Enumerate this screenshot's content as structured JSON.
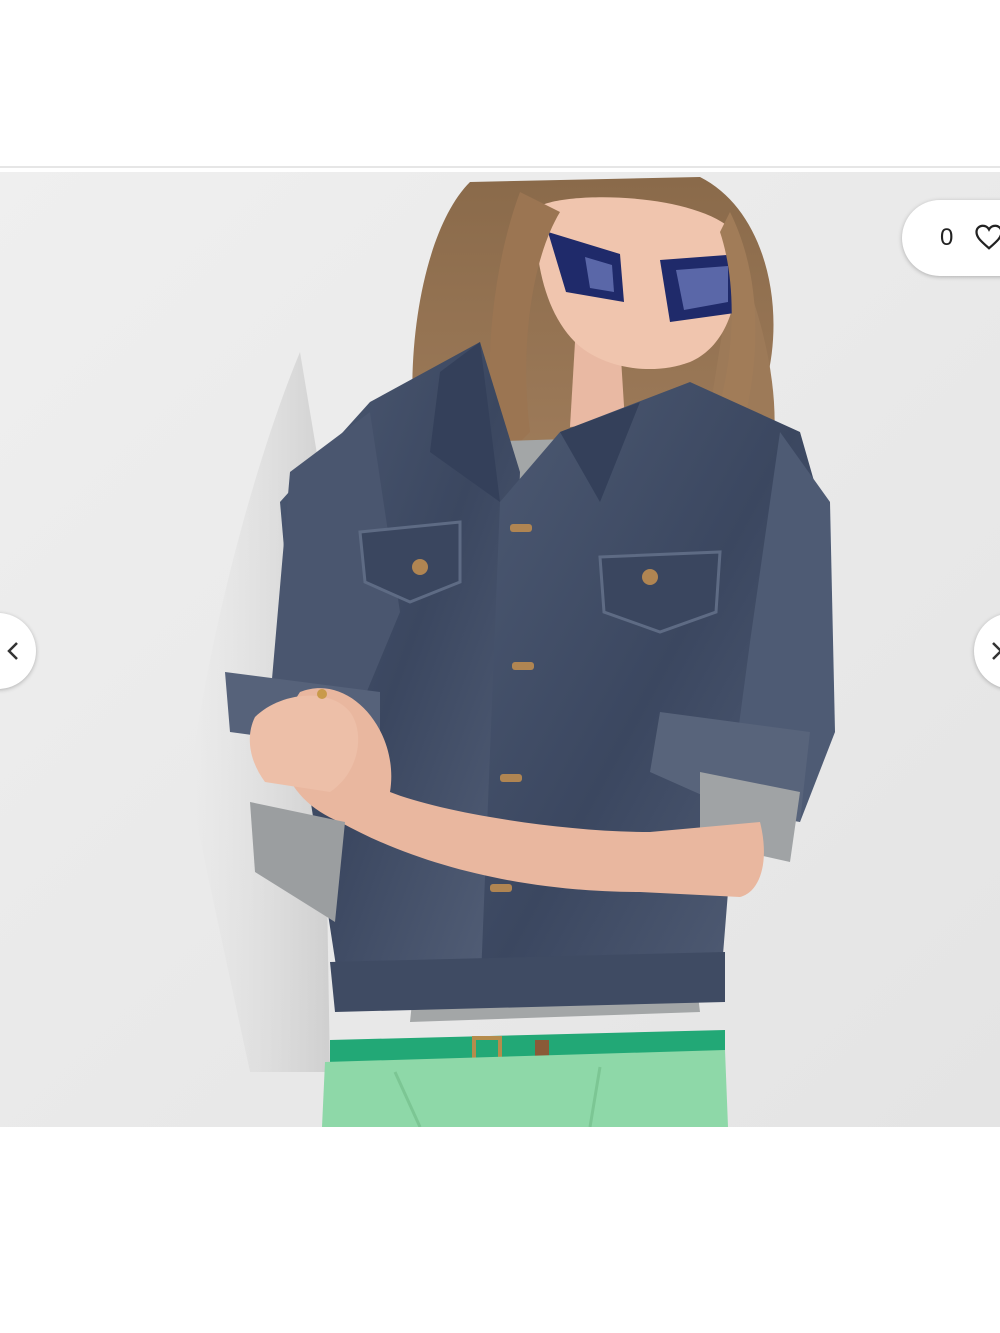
{
  "listing": {
    "like_count": "0",
    "icons": {
      "like": "heart-outline-icon",
      "previous": "chevron-left-icon",
      "next": "chevron-right-icon"
    },
    "colors": {
      "page_background": "#ffffff",
      "photo_backdrop": "#ececec",
      "denim": "#3f4b63",
      "pants": "#8ed8a8",
      "belt": "#22a876"
    }
  }
}
